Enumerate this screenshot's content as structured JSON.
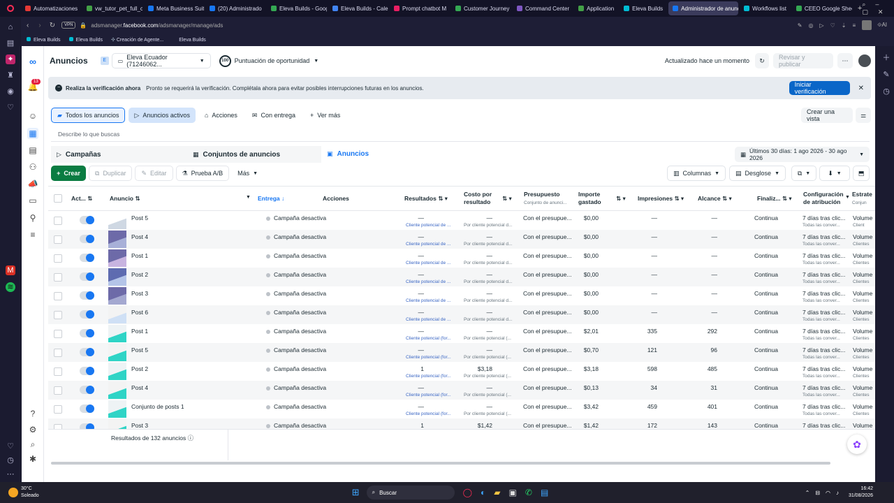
{
  "browser": {
    "tabs": [
      {
        "label": "Automatizaciones",
        "color": "#e53935"
      },
      {
        "label": "vw_tutor_pet_full_c",
        "color": "#43a047"
      },
      {
        "label": "Meta Business Suit",
        "color": "#1877f2"
      },
      {
        "label": "(20) Administrado",
        "color": "#1877f2"
      },
      {
        "label": "Eleva Builds - Goog",
        "color": "#34a853"
      },
      {
        "label": "Eleva Builds - Cale",
        "color": "#4285f4"
      },
      {
        "label": "Prompt chatbot M",
        "color": "#e91e63"
      },
      {
        "label": "Customer Journey",
        "color": "#34a853"
      },
      {
        "label": "Command Center",
        "color": "#7e57c2"
      },
      {
        "label": "Application",
        "color": "#43a047"
      },
      {
        "label": "Eleva Builds",
        "color": "#00bcd4"
      },
      {
        "label": "Administrador de anuncio",
        "color": "#1877f2",
        "active": true
      },
      {
        "label": "Workflows list",
        "color": "#00bcd4"
      },
      {
        "label": "CEEO Google Shee",
        "color": "#34a853"
      }
    ],
    "url_prefix": "adsmanager.",
    "url_domain": "facebook.com",
    "url_path": "/adsmanager/manage/ads",
    "vpn_label": "VPN",
    "ai_label": "AI",
    "bookmarks": [
      "Eleva Builds",
      "Eleva Builds",
      "Creación de Agente...",
      "Eleva Builds"
    ]
  },
  "header": {
    "title": "Anuncios",
    "account_initial": "E",
    "account_name": "Eleva Ecuador (71246062...",
    "score_value": "100",
    "score_label": "Puntuación de oportunidad",
    "updated": "Actualizado hace un momento",
    "review_publish": "Revisar y publicar",
    "notif_count": "13"
  },
  "banner": {
    "title": "Realiza la verificación ahora",
    "text": "Pronto se requerirá la verificación. Complétala ahora para evitar posibles interrupciones futuras en los anuncios.",
    "button": "Iniciar verificación"
  },
  "views": {
    "all": "Todos los anuncios",
    "active": "Anuncios activos",
    "actions": "Acciones",
    "delivery": "Con entrega",
    "more": "Ver más",
    "create_view": "Crear una vista"
  },
  "search": {
    "placeholder": "Describe lo que buscas"
  },
  "levels": {
    "campaigns": "Campañas",
    "adsets": "Conjuntos de anuncios",
    "ads": "Anuncios"
  },
  "date_range": "Últimos 30 días: 1 ago 2026 - 30 ago 2026",
  "toolbar": {
    "create": "Crear",
    "duplicate": "Duplicar",
    "edit": "Editar",
    "ab_test": "Prueba A/B",
    "more": "Más",
    "columns": "Columnas",
    "breakdown": "Desglose"
  },
  "columns": {
    "status": "Act...",
    "ad": "Anuncio",
    "delivery": "Entrega",
    "actions": "Acciones",
    "results": "Resultados",
    "cost1": "Costo por",
    "cost2": "resultado",
    "budget": "Presupuesto",
    "budget_sub": "Conjunto de anunci...",
    "spent1": "Importe",
    "spent2": "gastado",
    "impressions": "Impresiones",
    "reach": "Alcance",
    "ends": "Finaliz...",
    "attr1": "Configuración",
    "attr2": "de atribución",
    "strategy": "Estrate",
    "strategy_sub": "Conjun"
  },
  "rows": [
    {
      "name": "Post 5",
      "delivery": "Campaña desactiva",
      "results": "—",
      "results_sub": "Cliente potencial de ...",
      "cost": "—",
      "cost_sub": "Por cliente potencial d...",
      "budget": "Con el presupue...",
      "spent": "$0,00",
      "impressions": "—",
      "reach": "—",
      "ends": "Continua",
      "attr": "7 días tras clic...",
      "attr_sub": "Todas las conver...",
      "strategy": "Volume",
      "strategy_sub": "Client"
    },
    {
      "name": "Post 4",
      "delivery": "Campaña desactiva",
      "results": "—",
      "results_sub": "Cliente potencial de ...",
      "cost": "—",
      "cost_sub": "Por cliente potencial d...",
      "budget": "Con el presupue...",
      "spent": "$0,00",
      "impressions": "—",
      "reach": "—",
      "ends": "Continua",
      "attr": "7 días tras clic...",
      "attr_sub": "Todas las conver...",
      "strategy": "Volume",
      "strategy_sub": "Clientes"
    },
    {
      "name": "Post 1",
      "delivery": "Campaña desactiva",
      "results": "—",
      "results_sub": "Cliente potencial de ...",
      "cost": "—",
      "cost_sub": "Por cliente potencial d...",
      "budget": "Con el presupue...",
      "spent": "$0,00",
      "impressions": "—",
      "reach": "—",
      "ends": "Continua",
      "attr": "7 días tras clic...",
      "attr_sub": "Todas las conver...",
      "strategy": "Volume",
      "strategy_sub": "Clientes"
    },
    {
      "name": "Post 2",
      "delivery": "Campaña desactiva",
      "results": "—",
      "results_sub": "Cliente potencial de ...",
      "cost": "—",
      "cost_sub": "Por cliente potencial d...",
      "budget": "Con el presupue...",
      "spent": "$0,00",
      "impressions": "—",
      "reach": "—",
      "ends": "Continua",
      "attr": "7 días tras clic...",
      "attr_sub": "Todas las conver...",
      "strategy": "Volume",
      "strategy_sub": "Clientes"
    },
    {
      "name": "Post 3",
      "delivery": "Campaña desactiva",
      "results": "—",
      "results_sub": "Cliente potencial de ...",
      "cost": "—",
      "cost_sub": "Por cliente potencial d...",
      "budget": "Con el presupue...",
      "spent": "$0,00",
      "impressions": "—",
      "reach": "—",
      "ends": "Continua",
      "attr": "7 días tras clic...",
      "attr_sub": "Todas las conver...",
      "strategy": "Volume",
      "strategy_sub": "Clientes"
    },
    {
      "name": "Post 6",
      "delivery": "Campaña desactiva",
      "results": "—",
      "results_sub": "Cliente potencial de ...",
      "cost": "—",
      "cost_sub": "Por cliente potencial d...",
      "budget": "Con el presupue...",
      "spent": "$0,00",
      "impressions": "—",
      "reach": "—",
      "ends": "Continua",
      "attr": "7 días tras clic...",
      "attr_sub": "Todas las conver...",
      "strategy": "Volume",
      "strategy_sub": "Clientes"
    },
    {
      "name": "Post 1",
      "delivery": "Campaña desactiva",
      "results": "—",
      "results_sub": "Cliente potencial (for...",
      "cost": "—",
      "cost_sub": "Por cliente potencial (...",
      "budget": "Con el presupue...",
      "spent": "$2,01",
      "impressions": "335",
      "reach": "292",
      "ends": "Continua",
      "attr": "7 días tras clic...",
      "attr_sub": "Todas las conver...",
      "strategy": "Volume",
      "strategy_sub": "Clientes"
    },
    {
      "name": "Post 5",
      "delivery": "Campaña desactiva",
      "results": "—",
      "results_sub": "Cliente potencial (for...",
      "cost": "—",
      "cost_sub": "Por cliente potencial (...",
      "budget": "Con el presupue...",
      "spent": "$0,70",
      "impressions": "121",
      "reach": "96",
      "ends": "Continua",
      "attr": "7 días tras clic...",
      "attr_sub": "Todas las conver...",
      "strategy": "Volume",
      "strategy_sub": "Clientes"
    },
    {
      "name": "Post 2",
      "delivery": "Campaña desactiva",
      "results": "1",
      "results_sub": "Cliente potencial (for...",
      "cost": "$3,18",
      "cost_sub": "Por cliente potencial (...",
      "budget": "Con el presupue...",
      "spent": "$3,18",
      "impressions": "598",
      "reach": "485",
      "ends": "Continua",
      "attr": "7 días tras clic...",
      "attr_sub": "Todas las conver...",
      "strategy": "Volume",
      "strategy_sub": "Clientes"
    },
    {
      "name": "Post 4",
      "delivery": "Campaña desactiva",
      "results": "—",
      "results_sub": "Cliente potencial (for...",
      "cost": "—",
      "cost_sub": "Por cliente potencial (...",
      "budget": "Con el presupue...",
      "spent": "$0,13",
      "impressions": "34",
      "reach": "31",
      "ends": "Continua",
      "attr": "7 días tras clic...",
      "attr_sub": "Todas las conver...",
      "strategy": "Volume",
      "strategy_sub": "Clientes"
    },
    {
      "name": "Conjunto de posts 1",
      "delivery": "Campaña desactiva",
      "results": "—",
      "results_sub": "Cliente potencial (for...",
      "cost": "—",
      "cost_sub": "Por cliente potencial (...",
      "budget": "Con el presupue...",
      "spent": "$3,42",
      "impressions": "459",
      "reach": "401",
      "ends": "Continua",
      "attr": "7 días tras clic...",
      "attr_sub": "Todas las conver...",
      "strategy": "Volume",
      "strategy_sub": "Clientes"
    },
    {
      "name": "Post 3",
      "delivery": "Campaña desactiva",
      "results": "1",
      "results_sub": "",
      "cost": "$1,42",
      "cost_sub": "",
      "budget": "Con el presupue...",
      "spent": "$1,42",
      "impressions": "172",
      "reach": "143",
      "ends": "Continua",
      "attr": "7 días tras clic...",
      "attr_sub": "",
      "strategy": "Volume",
      "strategy_sub": ""
    }
  ],
  "footer": {
    "results_count": "Resultados de 132 anuncios"
  },
  "taskbar": {
    "weather_temp": "30°C",
    "weather_desc": "Soleado",
    "search": "Buscar",
    "time": "16:42",
    "date": "31/08/2026"
  },
  "colors": {
    "accent": "#1877f2",
    "create": "#0a7c42",
    "verify": "#0a66c8"
  }
}
